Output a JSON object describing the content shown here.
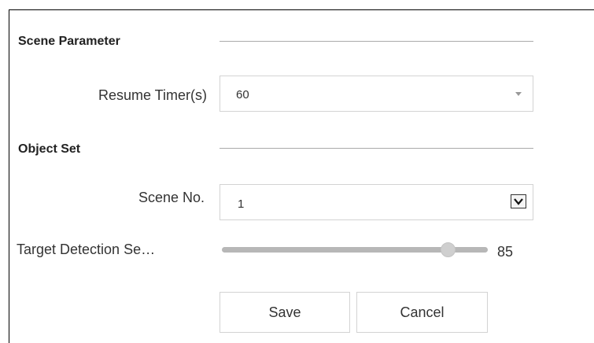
{
  "scene_parameter": {
    "title": "Scene Parameter",
    "resume_timer": {
      "label": "Resume Timer(s)",
      "value": "60"
    }
  },
  "object_set": {
    "title": "Object Set",
    "scene_no": {
      "label": "Scene No.",
      "value": "1"
    },
    "target_detection": {
      "label": "Target Detection Se…",
      "value_text": "85",
      "value": 85,
      "max": 100
    }
  },
  "buttons": {
    "save": "Save",
    "cancel": "Cancel"
  }
}
